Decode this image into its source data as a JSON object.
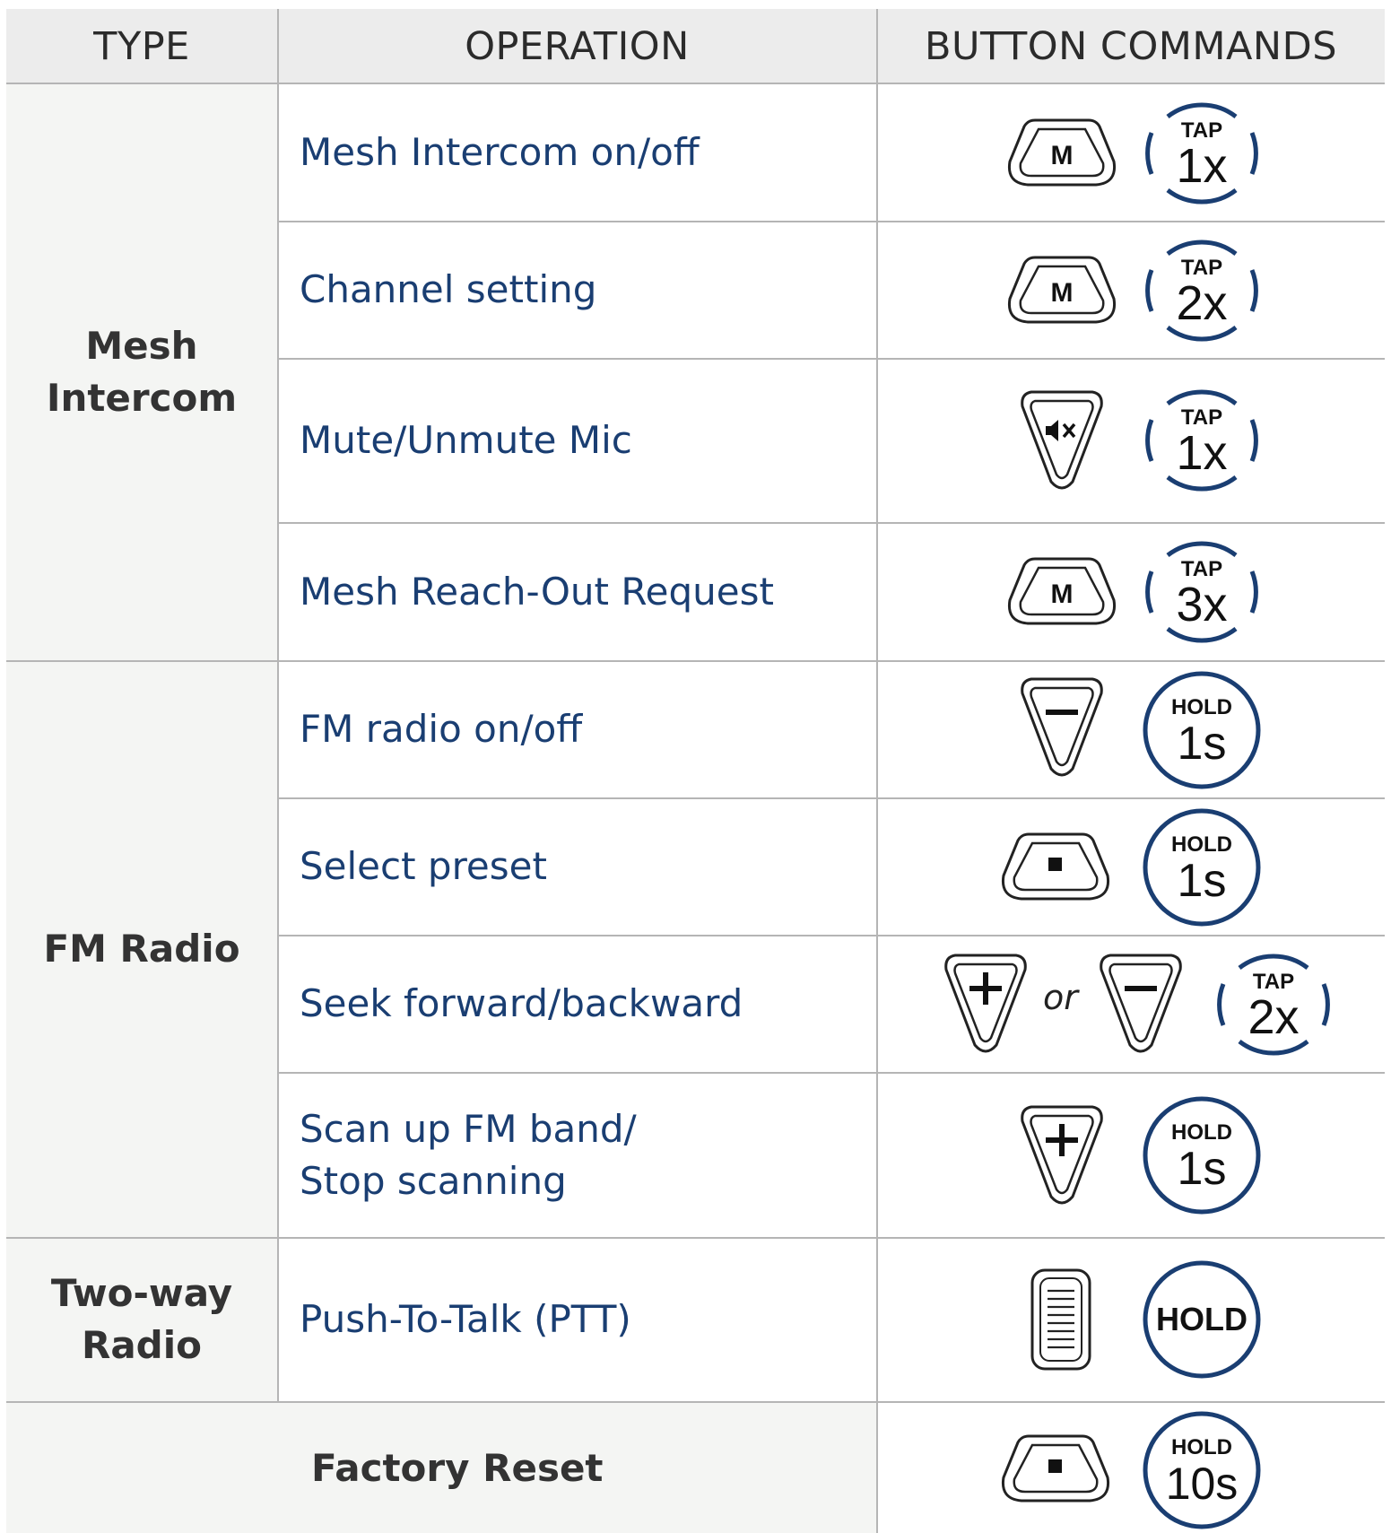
{
  "headers": {
    "type": "TYPE",
    "operation": "OPERATION",
    "commands": "BUTTON COMMANDS"
  },
  "groups": [
    {
      "label_line1": "Mesh",
      "label_line2": "Intercom"
    },
    {
      "label_line1": "FM Radio",
      "label_line2": ""
    },
    {
      "label_line1": "Two-way",
      "label_line2": "Radio"
    }
  ],
  "rows": [
    {
      "operation": "Mesh Intercom on/off",
      "button": "M",
      "badge_top": "TAP",
      "badge_main": "1x",
      "badge_kind": "tap"
    },
    {
      "operation": "Channel setting",
      "button": "M",
      "badge_top": "TAP",
      "badge_main": "2x",
      "badge_kind": "tap"
    },
    {
      "operation": "Mute/Unmute Mic",
      "button": "mute-icon",
      "badge_top": "TAP",
      "badge_main": "1x",
      "badge_kind": "tap"
    },
    {
      "operation": "Mesh Reach-Out Request",
      "button": "M",
      "badge_top": "TAP",
      "badge_main": "3x",
      "badge_kind": "tap"
    },
    {
      "operation": "FM radio on/off",
      "button": "minus-icon",
      "badge_top": "HOLD",
      "badge_main": "1s",
      "badge_kind": "hold"
    },
    {
      "operation": "Select preset",
      "button": "center-dot-icon",
      "badge_top": "HOLD",
      "badge_main": "1s",
      "badge_kind": "hold"
    },
    {
      "operation": "Seek forward/backward",
      "button": "plus-icon / minus-icon",
      "or_text": "or",
      "badge_top": "TAP",
      "badge_main": "2x",
      "badge_kind": "tap"
    },
    {
      "operation_line1": "Scan up FM band/",
      "operation_line2": "Stop scanning",
      "button": "plus-icon",
      "badge_top": "HOLD",
      "badge_main": "1s",
      "badge_kind": "hold"
    },
    {
      "operation": "Push-To-Talk (PTT)",
      "button": "ptt-grip-icon",
      "badge_main": "HOLD",
      "badge_kind": "hold-only"
    },
    {
      "operation": "Factory Reset",
      "button": "center-dot-icon",
      "badge_top": "HOLD",
      "badge_main": "10s",
      "badge_kind": "hold"
    }
  ],
  "colors": {
    "accent": "#1a3e72",
    "header_bg": "#ececec",
    "type_bg": "#f4f5f3",
    "grid": "#b5b5b5"
  }
}
